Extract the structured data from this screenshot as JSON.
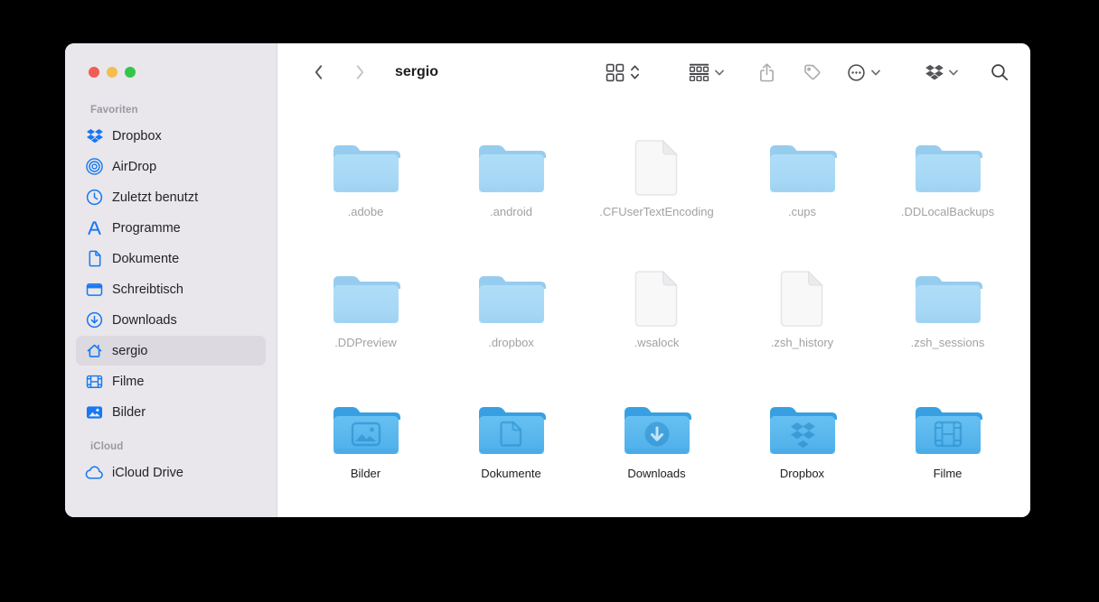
{
  "window": {
    "app": "Finder",
    "traffic_lights": [
      "close",
      "minimize",
      "zoom"
    ]
  },
  "colors": {
    "close_red": "#F25C54",
    "minimize_yellow": "#F5BD4E",
    "zoom_green": "#33C648",
    "sidebar_bg": "#E9E7EC",
    "selection_bg": "#DCDAE0",
    "accent_blue": "#1778F2",
    "folder_body_blue": "#58B9EF",
    "folder_tab_blue": "#38A0E2",
    "toolbar_icon_gray": "#48484C"
  },
  "toolbar": {
    "title": "sergio",
    "controls": {
      "back": "back",
      "forward": "forward",
      "view_switcher": "icon-view",
      "group_by": "group-by",
      "share": "share",
      "tags": "tags",
      "more_actions": "more-actions",
      "dropbox": "dropbox-status",
      "search": "search"
    }
  },
  "sidebar": {
    "sections": [
      {
        "label": "Favoriten",
        "items": [
          {
            "label": "Dropbox",
            "icon": "dropbox-icon",
            "selected": false
          },
          {
            "label": "AirDrop",
            "icon": "airdrop-icon",
            "selected": false
          },
          {
            "label": "Zuletzt benutzt",
            "icon": "clock-icon",
            "selected": false
          },
          {
            "label": "Programme",
            "icon": "applications-icon",
            "selected": false
          },
          {
            "label": "Dokumente",
            "icon": "document-icon",
            "selected": false
          },
          {
            "label": "Schreibtisch",
            "icon": "desktop-icon",
            "selected": false
          },
          {
            "label": "Downloads",
            "icon": "download-icon",
            "selected": false
          },
          {
            "label": "sergio",
            "icon": "home-icon",
            "selected": true
          },
          {
            "label": "Filme",
            "icon": "film-icon",
            "selected": false
          },
          {
            "label": "Bilder",
            "icon": "image-icon",
            "selected": false
          }
        ]
      },
      {
        "label": "iCloud",
        "items": [
          {
            "label": "iCloud Drive",
            "icon": "cloud-icon",
            "selected": false
          }
        ]
      }
    ]
  },
  "grid": {
    "items": [
      {
        "label": ".adobe",
        "type": "folder",
        "glyph": "",
        "hidden": true
      },
      {
        "label": ".android",
        "type": "folder",
        "glyph": "",
        "hidden": true
      },
      {
        "label": ".CFUserTextEncoding",
        "type": "file",
        "glyph": "",
        "hidden": true
      },
      {
        "label": ".cups",
        "type": "folder",
        "glyph": "",
        "hidden": true
      },
      {
        "label": ".DDLocalBackups",
        "type": "folder",
        "glyph": "",
        "hidden": true
      },
      {
        "label": ".DDPreview",
        "type": "folder",
        "glyph": "",
        "hidden": true
      },
      {
        "label": ".dropbox",
        "type": "folder",
        "glyph": "",
        "hidden": true
      },
      {
        "label": ".wsalock",
        "type": "file",
        "glyph": "",
        "hidden": true
      },
      {
        "label": ".zsh_history",
        "type": "file",
        "glyph": "",
        "hidden": true
      },
      {
        "label": ".zsh_sessions",
        "type": "folder",
        "glyph": "",
        "hidden": true
      },
      {
        "label": "Bilder",
        "type": "folder",
        "glyph": "image",
        "hidden": false
      },
      {
        "label": "Dokumente",
        "type": "folder",
        "glyph": "document",
        "hidden": false
      },
      {
        "label": "Downloads",
        "type": "folder",
        "glyph": "download",
        "hidden": false
      },
      {
        "label": "Dropbox",
        "type": "folder",
        "glyph": "dropbox",
        "hidden": false
      },
      {
        "label": "Filme",
        "type": "folder",
        "glyph": "film",
        "hidden": false
      }
    ]
  }
}
